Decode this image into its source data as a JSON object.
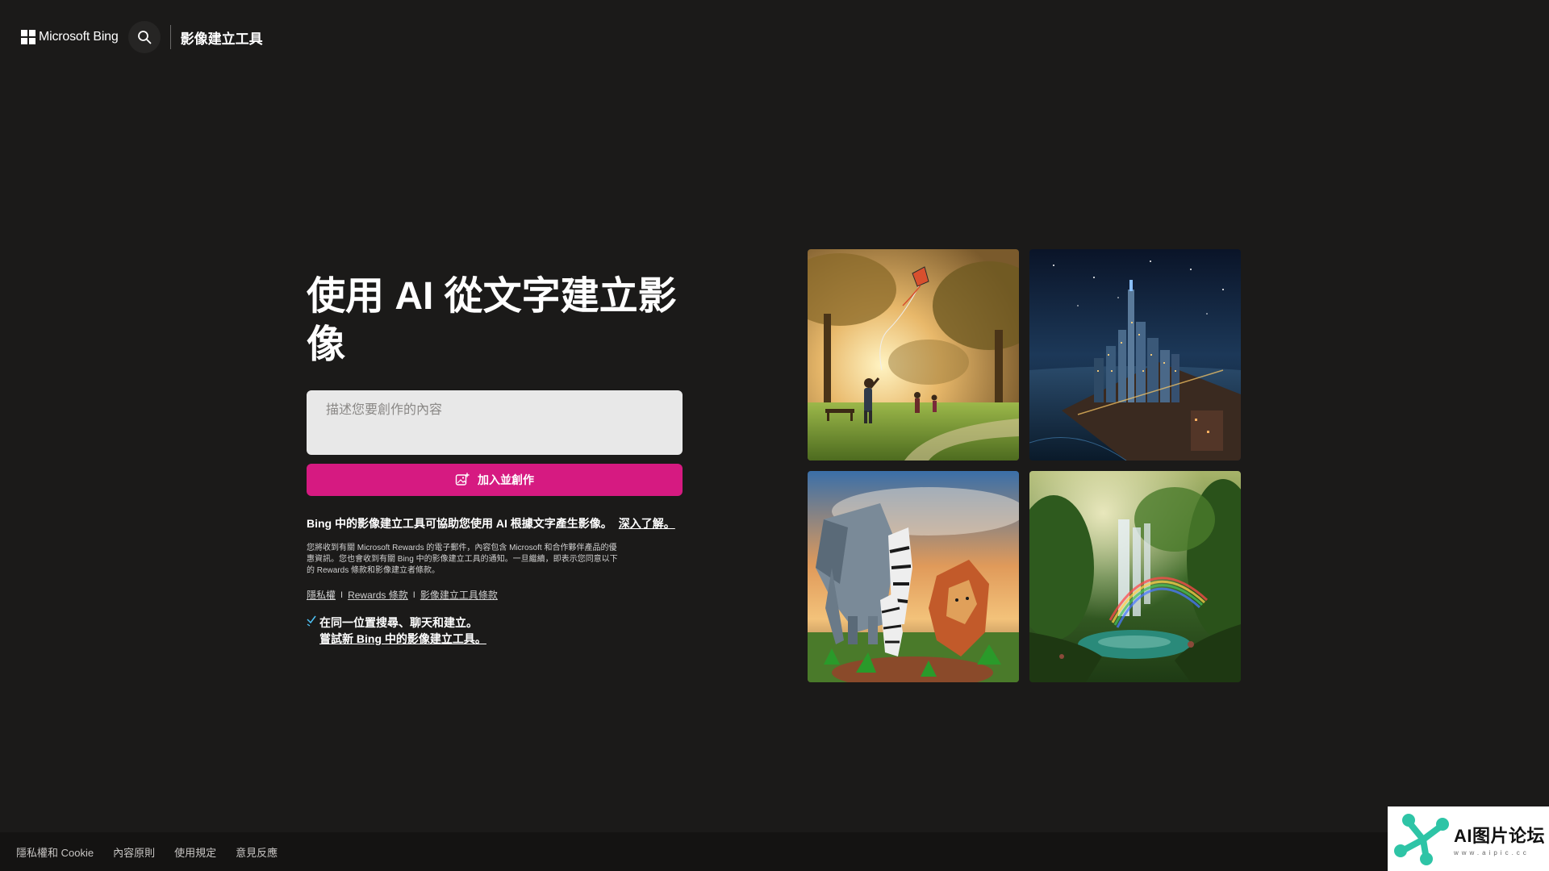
{
  "header": {
    "brand": "Microsoft Bing",
    "product": "影像建立工具",
    "icons": {
      "logo": "windows-logo-icon",
      "search": "search-icon"
    }
  },
  "hero": {
    "title": "使用 AI 從文字建立影像"
  },
  "prompt": {
    "placeholder": "描述您要創作的內容",
    "value": ""
  },
  "create_button": {
    "label": "加入並創作",
    "icon": "image-create-icon",
    "color": "#d61a81"
  },
  "description": {
    "text": "Bing 中的影像建立工具可協助您使用 AI 根據文字產生影像。",
    "learn_more": "深入了解。"
  },
  "fine_print": "您將收到有關 Microsoft Rewards 的電子郵件，內容包含 Microsoft 和合作夥伴產品的優惠資訊。您也會收到有關 Bing 中的影像建立工具的通知。一旦繼續，即表示您同意以下的 Rewards 條款和影像建立者條款。",
  "terms_links": {
    "privacy": "隱私權",
    "rewards_terms": "Rewards 條款",
    "creator_terms": "影像建立工具條款",
    "separator": "I"
  },
  "promo": {
    "icon": "sparkle-icon",
    "line1": "在同一位置搜尋、聊天和建立。",
    "link": "嘗試新 Bing 中的影像建立工具。"
  },
  "gallery": [
    {
      "name": "gallery-image-park-kite",
      "icon": "park-kite-image"
    },
    {
      "name": "gallery-image-night-city",
      "icon": "night-city-image"
    },
    {
      "name": "gallery-image-origami-animals",
      "icon": "origami-animals-image"
    },
    {
      "name": "gallery-image-waterfall-rainbow",
      "icon": "waterfall-rainbow-image"
    }
  ],
  "footer": {
    "links": [
      "隱私權和 Cookie",
      "內容原則",
      "使用規定",
      "意見反應"
    ]
  },
  "watermark": {
    "title": "AI图片论坛",
    "subtitle": "www.aipic.cc"
  },
  "colors": {
    "background": "#1b1a19",
    "footer": "#141312",
    "accent": "#d61a81"
  }
}
